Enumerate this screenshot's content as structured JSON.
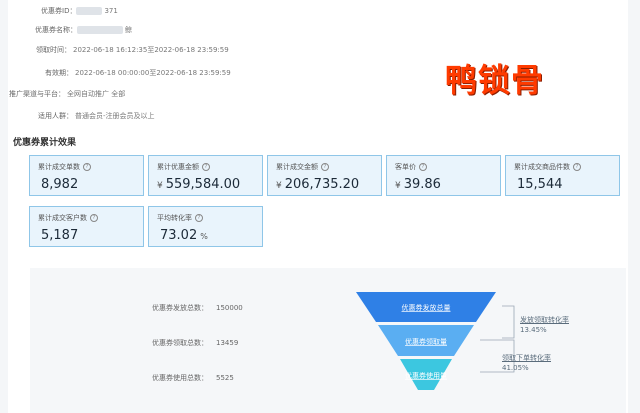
{
  "info": [
    {
      "label": "优惠券ID：",
      "value": "371"
    },
    {
      "label": "优惠券名称：",
      "value": "鲸"
    },
    {
      "label": "领取时间：",
      "value": "2022-06-18 16:12:35至2022-06-18 23:59:59"
    },
    {
      "label": "有效期：",
      "value": "2022-06-18 00:00:00至2022-06-18 23:59:59"
    },
    {
      "label": "推广渠道与平台：",
      "value": "全网自动推广 全部"
    },
    {
      "label": "适用人群：",
      "value": "普通会员-注册会员及以上"
    }
  ],
  "watermark": "鸭锁骨",
  "section_title": "优惠券累计效果",
  "cards": [
    {
      "title": "累计成交单数",
      "unit": "",
      "value": "8,982",
      "suffix": ""
    },
    {
      "title": "累计优惠金额",
      "unit": "¥",
      "value": "559,584.00",
      "suffix": ""
    },
    {
      "title": "累计成交金额",
      "unit": "¥",
      "value": "206,735.20",
      "suffix": ""
    },
    {
      "title": "客单价",
      "unit": "¥",
      "value": "39.86",
      "suffix": ""
    },
    {
      "title": "累计成交商品件数",
      "unit": "",
      "value": "15,544",
      "suffix": ""
    },
    {
      "title": "累计成交客户数",
      "unit": "",
      "value": "5,187",
      "suffix": ""
    },
    {
      "title": "平均转化率",
      "unit": "",
      "value": "73.02",
      "suffix": "%"
    }
  ],
  "funnel": {
    "stats": [
      {
        "label": "优惠券发放总数：",
        "value": "150000"
      },
      {
        "label": "优惠券领取总数：",
        "value": "13459"
      },
      {
        "label": "优惠券使用总数：",
        "value": "5525"
      }
    ],
    "stages": [
      "优惠券发放总量",
      "优惠券领取量",
      "优惠券使用量"
    ],
    "rates": [
      {
        "label": "发放领取转化率",
        "value": "13.45%"
      },
      {
        "label": "领取下单转化率",
        "value": "41.05%"
      }
    ],
    "colors": {
      "top": "#2f80e6",
      "mid": "#5aaef2",
      "bottom": "#3cc7e0"
    }
  }
}
